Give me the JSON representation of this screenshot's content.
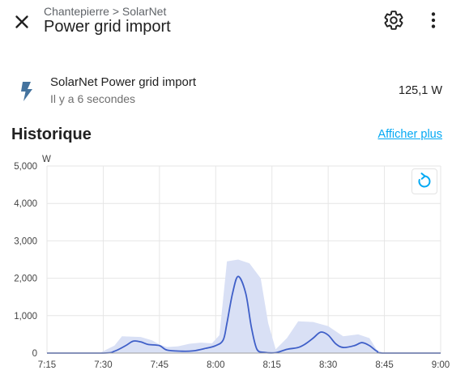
{
  "header": {
    "breadcrumb": "Chantepierre > SolarNet",
    "title": "Power grid import"
  },
  "entity": {
    "name": "SolarNet Power grid import",
    "last_changed": "Il y a 6 secondes",
    "value": "125,1 W"
  },
  "history": {
    "title": "Historique",
    "show_more": "Afficher plus"
  },
  "colors": {
    "accent": "#03a9f4",
    "line": "#3f5fc8",
    "band": "#d9e0f5",
    "icon": "#44739e"
  },
  "chart_data": {
    "type": "line",
    "unit_label": "W",
    "y_ticks": [
      "0",
      "1,000",
      "2,000",
      "3,000",
      "4,000",
      "5,000"
    ],
    "ylim": [
      0,
      5000
    ],
    "x_ticks": [
      "7:15",
      "7:30",
      "7:45",
      "8:00",
      "8:15",
      "8:30",
      "8:45",
      "9:00"
    ],
    "x_tick_minutes": [
      435,
      450,
      465,
      480,
      495,
      510,
      525,
      540
    ],
    "xlim_minutes": [
      435,
      540
    ],
    "grid": true,
    "series": [
      {
        "kind": "mean-line",
        "points": [
          [
            435,
            0
          ],
          [
            450,
            0
          ],
          [
            453,
            50
          ],
          [
            456,
            200
          ],
          [
            458,
            320
          ],
          [
            460,
            300
          ],
          [
            462,
            230
          ],
          [
            465,
            200
          ],
          [
            467,
            80
          ],
          [
            471,
            50
          ],
          [
            474,
            60
          ],
          [
            477,
            120
          ],
          [
            480,
            200
          ],
          [
            482,
            350
          ],
          [
            483,
            800
          ],
          [
            484.5,
            1600
          ],
          [
            486,
            2050
          ],
          [
            488,
            1600
          ],
          [
            489.5,
            700
          ],
          [
            491,
            100
          ],
          [
            493,
            20
          ],
          [
            496,
            10
          ],
          [
            499,
            100
          ],
          [
            502,
            150
          ],
          [
            504,
            250
          ],
          [
            506,
            400
          ],
          [
            508,
            560
          ],
          [
            510,
            480
          ],
          [
            512,
            250
          ],
          [
            514,
            150
          ],
          [
            517,
            200
          ],
          [
            519,
            280
          ],
          [
            521,
            200
          ],
          [
            523,
            50
          ],
          [
            525,
            0
          ],
          [
            540,
            0
          ]
        ]
      },
      {
        "kind": "min-max-band",
        "upper": [
          [
            435,
            0
          ],
          [
            449,
            0
          ],
          [
            453,
            200
          ],
          [
            455,
            450
          ],
          [
            460,
            430
          ],
          [
            463,
            340
          ],
          [
            465,
            230
          ],
          [
            467,
            160
          ],
          [
            470,
            180
          ],
          [
            473,
            250
          ],
          [
            476,
            280
          ],
          [
            479,
            260
          ],
          [
            481,
            480
          ],
          [
            483,
            2450
          ],
          [
            486,
            2500
          ],
          [
            489,
            2400
          ],
          [
            492,
            2000
          ],
          [
            494,
            800
          ],
          [
            496,
            100
          ],
          [
            499,
            400
          ],
          [
            502,
            850
          ],
          [
            506,
            830
          ],
          [
            510,
            720
          ],
          [
            514,
            450
          ],
          [
            518,
            500
          ],
          [
            521,
            400
          ],
          [
            523,
            80
          ],
          [
            525,
            0
          ],
          [
            540,
            0
          ]
        ],
        "lower": [
          [
            435,
            0
          ],
          [
            540,
            0
          ]
        ]
      }
    ]
  }
}
